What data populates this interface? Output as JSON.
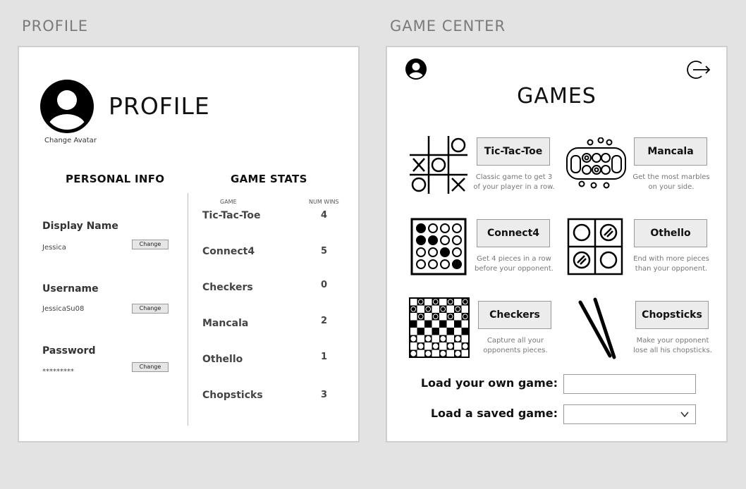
{
  "sections": {
    "profile_label": "PROFILE",
    "game_center_label": "GAME CENTER"
  },
  "profile": {
    "title": "PROFILE",
    "change_avatar": "Change Avatar",
    "personal_info_heading": "PERSONAL INFO",
    "game_stats_heading": "GAME STATS",
    "fields": [
      {
        "label": "Display Name",
        "value": "Jessica",
        "button": "Change"
      },
      {
        "label": "Username",
        "value": "JessicaSu08",
        "button": "Change"
      },
      {
        "label": "Password",
        "value": "*********",
        "button": "Change"
      }
    ],
    "stats_columns": {
      "game": "GAME",
      "wins": "NUM WINS"
    },
    "stats": [
      {
        "game": "Tic-Tac-Toe",
        "wins": "4"
      },
      {
        "game": "Connect4",
        "wins": "5"
      },
      {
        "game": "Checkers",
        "wins": "0"
      },
      {
        "game": "Mancala",
        "wins": "2"
      },
      {
        "game": "Othello",
        "wins": "1"
      },
      {
        "game": "Chopsticks",
        "wins": "3"
      }
    ]
  },
  "game_center": {
    "title": "GAMES",
    "games": [
      {
        "name": "Tic-Tac-Toe",
        "icon": "tic-tac-toe-icon",
        "desc_1": "Classic game to get 3",
        "desc_2": "of your player in a row."
      },
      {
        "name": "Mancala",
        "icon": "mancala-icon",
        "desc_1": "Get the most marbles",
        "desc_2": "on your side."
      },
      {
        "name": "Connect4",
        "icon": "connect4-icon",
        "desc_1": "Get 4 pieces in a row",
        "desc_2": "before your opponent."
      },
      {
        "name": "Othello",
        "icon": "othello-icon",
        "desc_1": "End with more pieces",
        "desc_2": "than your opponent."
      },
      {
        "name": "Checkers",
        "icon": "checkers-icon",
        "desc_1": "Capture all your",
        "desc_2": "opponents pieces."
      },
      {
        "name": "Chopsticks",
        "icon": "chopsticks-icon",
        "desc_1": "Make your opponent",
        "desc_2": "lose all his chopsticks."
      }
    ],
    "load_own_label": "Load your own game:",
    "load_own_value": "",
    "load_saved_label": "Load a saved game:",
    "load_saved_value": ""
  }
}
